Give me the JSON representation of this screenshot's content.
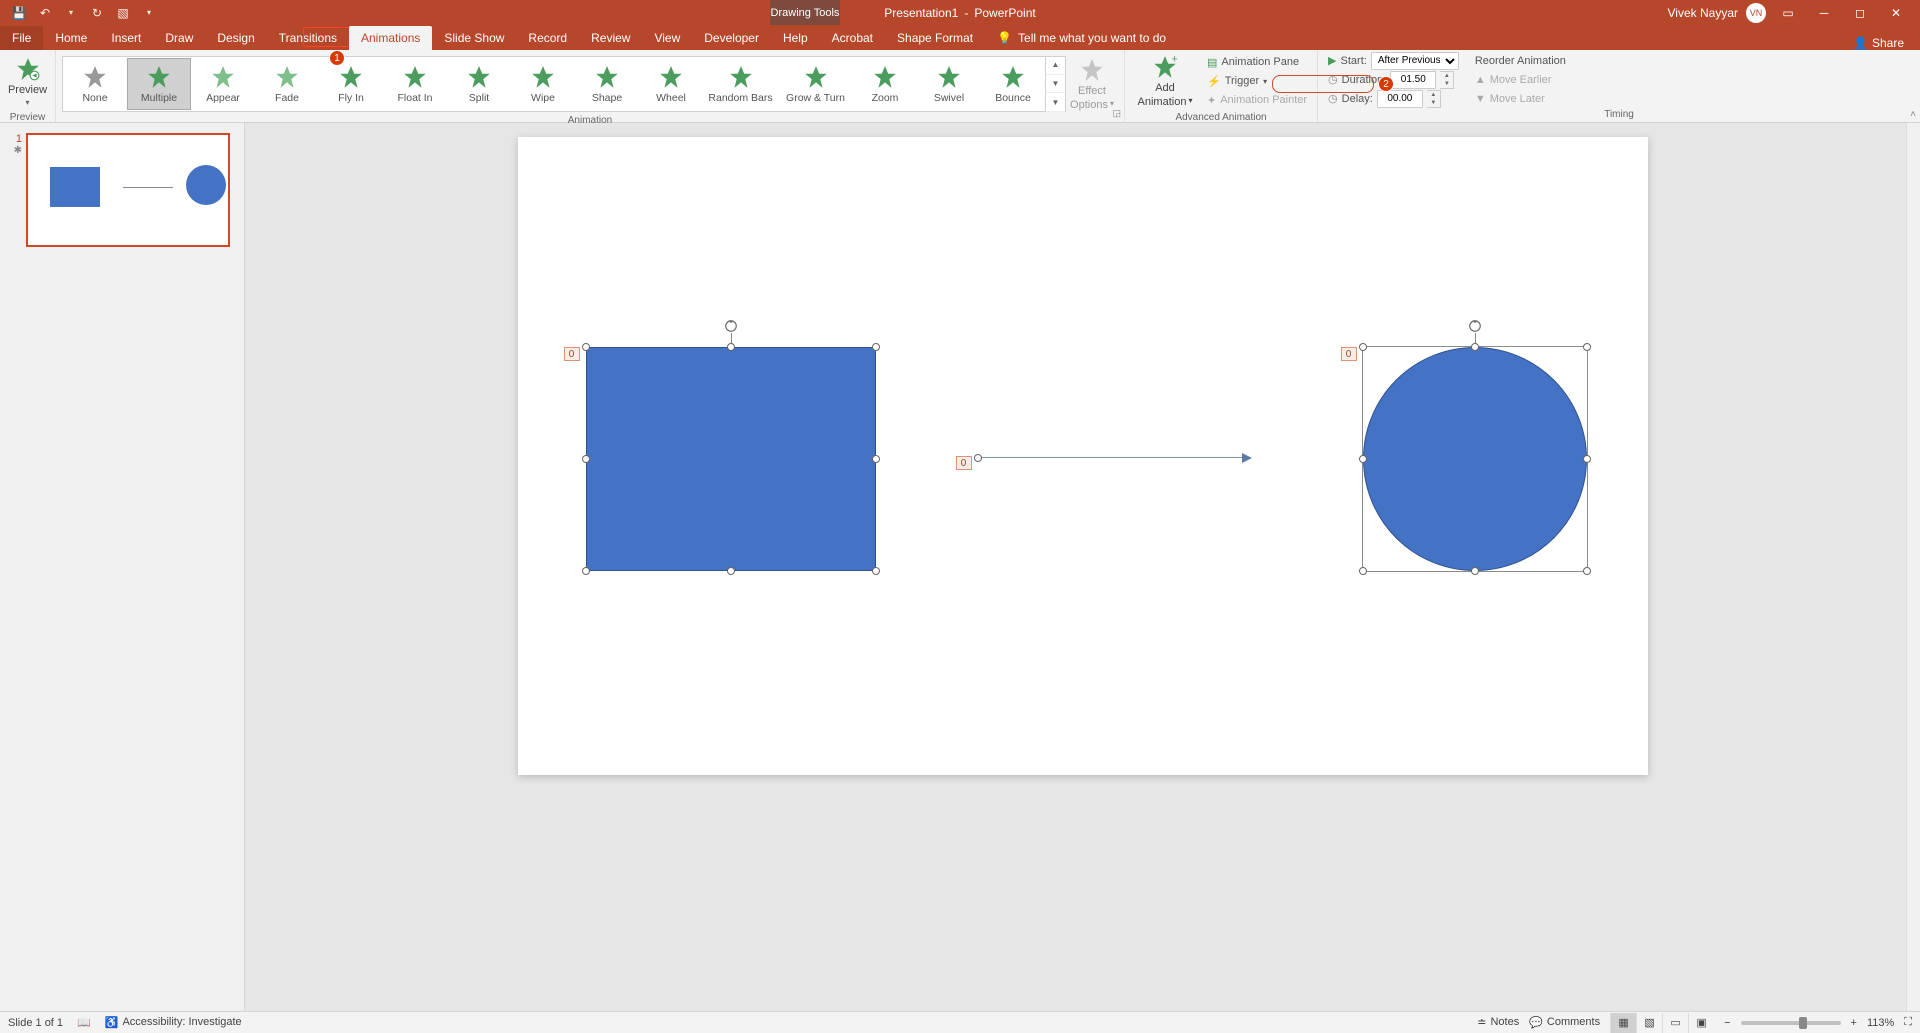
{
  "title": {
    "doc": "Presentation1",
    "app": "PowerPoint",
    "sep": "-",
    "contextTab": "Drawing Tools"
  },
  "user": {
    "name": "Vivek Nayyar",
    "initials": "VN"
  },
  "tabs": {
    "file": "File",
    "home": "Home",
    "insert": "Insert",
    "draw": "Draw",
    "design": "Design",
    "transitions": "Transitions",
    "animations": "Animations",
    "slideshow": "Slide Show",
    "record": "Record",
    "review": "Review",
    "view": "View",
    "developer": "Developer",
    "help": "Help",
    "acrobat": "Acrobat",
    "shapeformat": "Shape Format",
    "tellme": "Tell me what you want to do",
    "share": "Share"
  },
  "badge1": "1",
  "badge2": "2",
  "ribbon": {
    "preview": {
      "label": "Preview",
      "group": "Preview"
    },
    "animationGroup": "Animation",
    "gallery": {
      "none": "None",
      "multiple": "Multiple",
      "appear": "Appear",
      "fade": "Fade",
      "flyin": "Fly In",
      "floatin": "Float In",
      "split": "Split",
      "wipe": "Wipe",
      "shape": "Shape",
      "wheel": "Wheel",
      "randombars": "Random Bars",
      "growturn": "Grow & Turn",
      "zoom": "Zoom",
      "swivel": "Swivel",
      "bounce": "Bounce"
    },
    "effectOptions": {
      "line1": "Effect",
      "line2": "Options"
    },
    "addAnimation": {
      "line1": "Add",
      "line2": "Animation"
    },
    "advAnim": {
      "pane": "Animation Pane",
      "trigger": "Trigger",
      "painter": "Animation Painter",
      "group": "Advanced Animation"
    },
    "timing": {
      "start": "Start:",
      "startVal": "After Previous",
      "duration": "Duration:",
      "durationVal": "01.50",
      "delay": "Delay:",
      "delayVal": "00.00",
      "reorder": "Reorder Animation",
      "earlier": "Move Earlier",
      "later": "Move Later",
      "group": "Timing"
    }
  },
  "slidePanel": {
    "num": "1",
    "star": "✱"
  },
  "canvas": {
    "tag0": "0",
    "tag1": "0",
    "tag2": "0"
  },
  "status": {
    "slide": "Slide 1 of 1",
    "accessibility": "Accessibility: Investigate",
    "notes": "Notes",
    "comments": "Comments",
    "zoom": "113%"
  }
}
